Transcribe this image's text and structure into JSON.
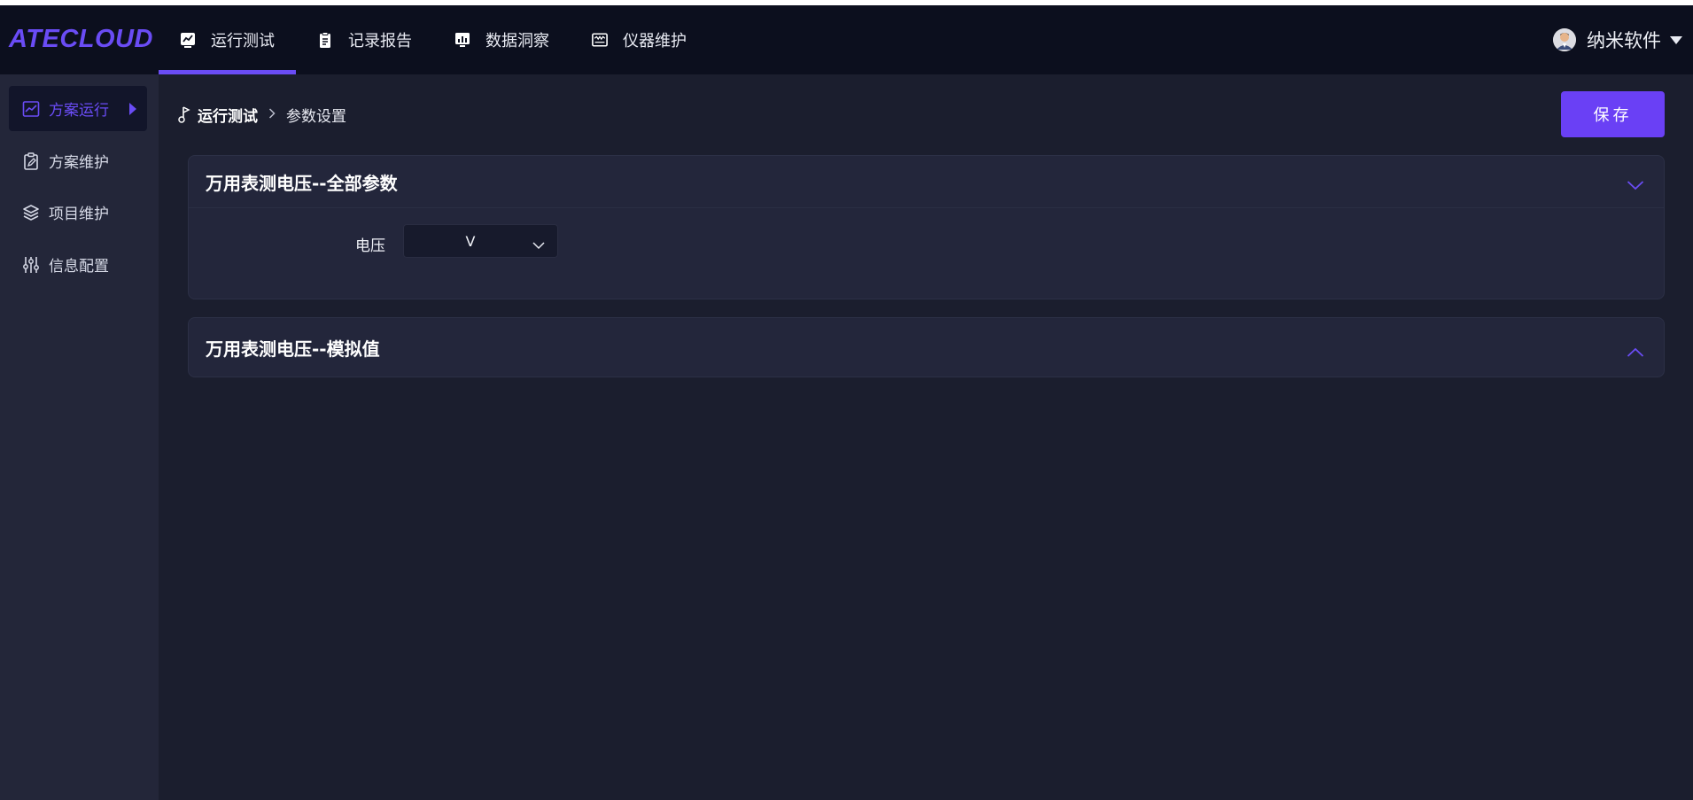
{
  "app": {
    "logo": "ATECLOUD"
  },
  "nav": {
    "items": [
      {
        "label": "运行测试",
        "icon": "chart-screen-icon",
        "active": true
      },
      {
        "label": "记录报告",
        "icon": "clipboard-icon",
        "active": false
      },
      {
        "label": "数据洞察",
        "icon": "bar-chart-icon",
        "active": false
      },
      {
        "label": "仪器维护",
        "icon": "instrument-icon",
        "active": false
      }
    ]
  },
  "user": {
    "name": "纳米软件"
  },
  "sidebar": {
    "items": [
      {
        "label": "方案运行",
        "icon": "line-chart-icon",
        "active": true
      },
      {
        "label": "方案维护",
        "icon": "clipboard-edit-icon",
        "active": false
      },
      {
        "label": "项目维护",
        "icon": "layers-icon",
        "active": false
      },
      {
        "label": "信息配置",
        "icon": "sliders-icon",
        "active": false
      }
    ]
  },
  "breadcrumb": {
    "home": "运行测试",
    "current": "参数设置"
  },
  "toolbar": {
    "save_label": "保存"
  },
  "panels": [
    {
      "title": "万用表测电压--全部参数",
      "expanded": true,
      "fields": [
        {
          "label": "电压",
          "value": "V"
        }
      ]
    },
    {
      "title": "万用表测电压--模拟值",
      "expanded": false
    }
  ],
  "colors": {
    "accent": "#6a4cf5",
    "topbar": "#0c0f1e",
    "background": "#1b1e2e",
    "sidebar": "#232639"
  }
}
